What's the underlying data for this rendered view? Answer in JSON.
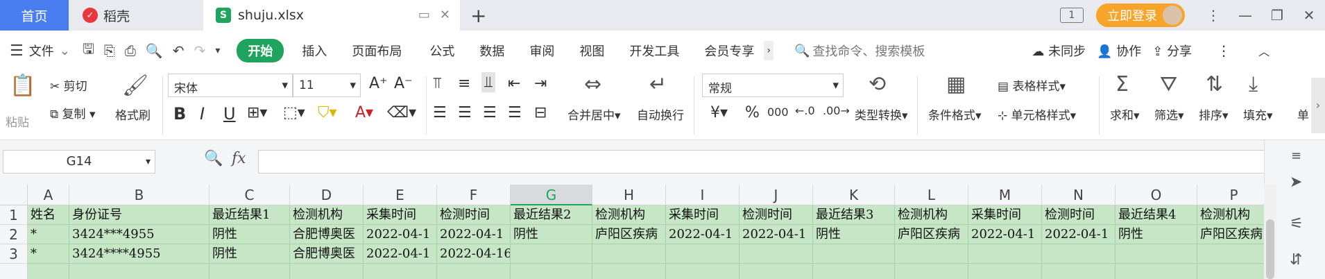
{
  "tabs": {
    "home": "首页",
    "daoke": "稻壳",
    "file": "shuju.xlsx"
  },
  "window": {
    "login": "立即登录",
    "page_indicator": "1"
  },
  "menubar": {
    "file_menu": "文件",
    "start": "开始",
    "items": [
      "插入",
      "页面布局",
      "公式",
      "数据",
      "审阅",
      "视图",
      "开发工具",
      "会员专享"
    ],
    "search_placeholder": "查找命令、搜索模板",
    "sync": "未同步",
    "collab": "协作",
    "share": "分享"
  },
  "ribbon": {
    "paste": "粘贴",
    "cut": "剪切",
    "copy": "复制",
    "format_painter": "格式刷",
    "font_name": "宋体",
    "font_size": "11",
    "merge_center": "合并居中",
    "wrap": "自动换行",
    "number_format": "常规",
    "type_convert": "类型转换",
    "cond_format": "条件格式",
    "table_style": "表格样式",
    "cell_style": "单元格样式",
    "sum": "求和",
    "filter": "筛选",
    "sort": "排序",
    "fill": "填充",
    "single": "单"
  },
  "formula_bar": {
    "name_box": "G14",
    "fx": "fx"
  },
  "sheet": {
    "columns": [
      "A",
      "B",
      "C",
      "D",
      "E",
      "F",
      "G",
      "H",
      "I",
      "J",
      "K",
      "L",
      "M",
      "N",
      "O",
      "P"
    ],
    "selected_column": "G",
    "rows": [
      [
        "姓名",
        "身份证号",
        "最近结果1",
        "检测机构",
        "采集时间",
        "检测时间",
        "最近结果2",
        "检测机构",
        "采集时间",
        "检测时间",
        "最近结果3",
        "检测机构",
        "采集时间",
        "检测时间",
        "最近结果4",
        "检测机构"
      ],
      [
        "*",
        "3424***4955",
        "阴性",
        "合肥博奥医",
        "2022-04-1",
        "2022-04-1",
        "阴性",
        "庐阳区疾病",
        "2022-04-1",
        "2022-04-1",
        "阴性",
        "庐阳区疾病",
        "2022-04-1",
        "2022-04-1",
        "阴性",
        "庐阳区疾病"
      ],
      [
        "*",
        "3424****4955",
        "阴性",
        "合肥博奥医",
        "2022-04-1",
        "2022-04-16",
        "",
        "",
        "",
        "",
        "",
        "",
        "",
        "",
        "",
        ""
      ],
      [
        "",
        "",
        "",
        "",
        "",
        "",
        "",
        "",
        "",
        "",
        "",
        "",
        "",
        "",
        "",
        ""
      ]
    ],
    "row_numbers": [
      "1",
      "2",
      "3",
      ""
    ]
  }
}
